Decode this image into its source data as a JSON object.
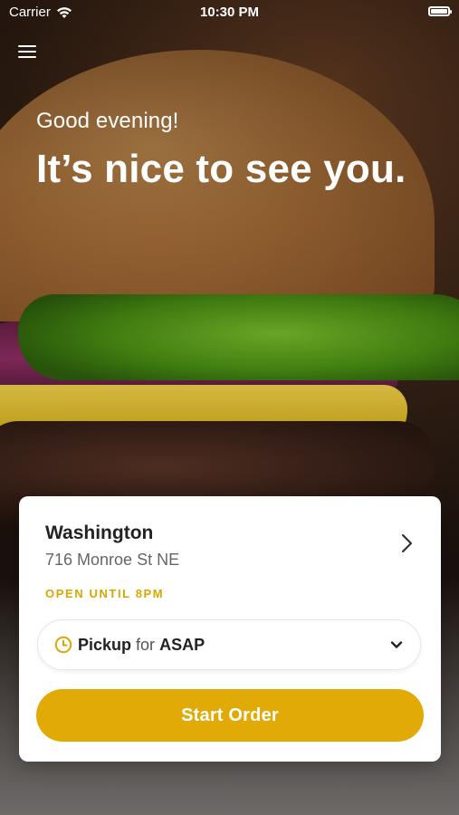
{
  "status_bar": {
    "carrier": "Carrier",
    "time": "10:30 PM"
  },
  "header": {
    "menu_icon": "hamburger-menu-icon"
  },
  "hero": {
    "greeting": "Good evening!",
    "headline": "It’s nice to see you."
  },
  "location_card": {
    "name": "Washington",
    "address": "716 Monroe St NE",
    "hours_status": "OPEN UNTIL 8PM",
    "order_mode": {
      "type": "Pickup",
      "connector": "for",
      "time": "ASAP"
    },
    "start_button_label": "Start Order"
  },
  "colors": {
    "accent": "#E2AA06",
    "accent_text": "#D9A600",
    "card_bg": "#FFFFFF"
  }
}
